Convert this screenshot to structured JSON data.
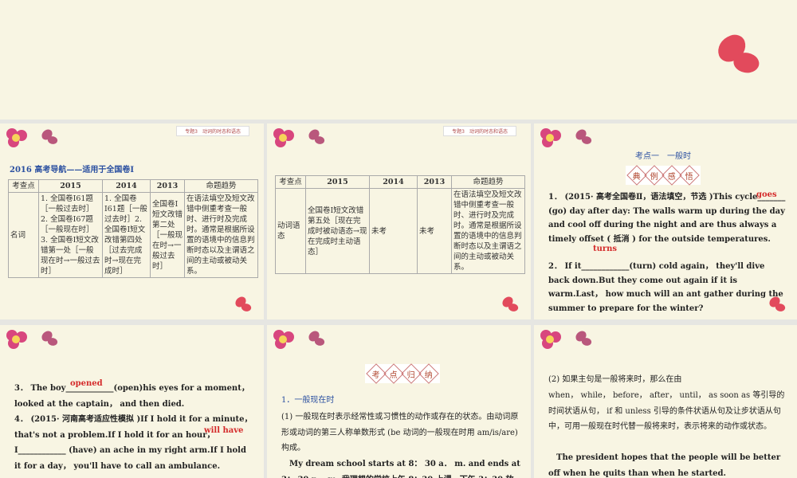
{
  "header_tag": "专题3　动词的时态和语态",
  "slide1": {
    "title": "2016 高考导航——适用于全国卷Ⅰ",
    "headers": [
      "考查点",
      "2015",
      "2014",
      "2013",
      "命题趋势"
    ],
    "row": [
      "名词",
      "1. 全国卷Ⅰ61题［一般过去时］2. 全国卷Ⅰ67题［一般现在时］3. 全国卷Ⅰ短文改错第一处［一般现在时→一般过去时］",
      "1. 全国卷Ⅰ61题［一般过去时］2. 全国卷Ⅰ短文改错第四处［过去完成时→现在完成时］",
      "全国卷Ⅰ短文改错第二处［一般现在时→一般过去时］",
      "在语法填空及短文改错中侧重考查一般时、进行时及完成时。通常是根据所设置的语境中的信息判断时态以及主谓语之间的主动或被动关系。"
    ]
  },
  "slide2": {
    "headers": [
      "考查点",
      "2015",
      "2014",
      "2013",
      "命题趋势"
    ],
    "row": [
      "动词语态",
      "全国卷Ⅰ短文改错第五处［现在完成时被动语态→现在完成时主动语态］",
      "未考",
      "未考",
      "在语法填空及短文改错中侧重考查一般时、进行时及完成时。通常是根据所设置的语境中的信息判断时态以及主谓语之间的主动或被动关系。"
    ]
  },
  "slide3": {
    "subtitle": "考点一　一般时",
    "badge": [
      "典",
      "例",
      "感",
      "悟"
    ],
    "q1": "1． (2015· 高考全国卷Ⅱ，语法填空，节选 )This cycle_______ (go) day after day: The walls warm up during the day and cool off during the night and are thus always a timely offset ( 抵消 ) for the outside temperatures.",
    "a1": "goes",
    "q2": "2． If it____________(turn) cold again， they'll dive back down.But they come out again if it is warm.Last， how much will an ant gather during the summer to prepare for the winter?",
    "a2": "turns"
  },
  "slide4": {
    "q3": "3． The boy____________(open)his eyes for a moment，looked at the captain， and then died.",
    "a3": "opened",
    "q4": "4． (2015· 河南高考适应性模拟 )If I hold it for a minute，that's not a problem.If I hold it for an hour， I____________ (have) an ache in my right arm.If I hold it for a day， you'll have to call an ambulance.",
    "a4": "will have"
  },
  "slide5": {
    "badge": [
      "考",
      "点",
      "归",
      "纳"
    ],
    "heading": "1．一般现在时",
    "p1": "(1) 一般现在时表示经常性或习惯性的动作或存在的状态。由动词原形或动词的第三人称单数形式 (be 动词的一般现在时用 am/is/are) 构成。",
    "example": "My dream school starts at 8： 30 a． m. and ends at 3： 30 p． m. 我理想的学校上午 8：30 上课，下午 3：30 放"
  },
  "slide6": {
    "p1": "(2) 如果主句是一般将来时，那么在由",
    "p2": "when， while， before， after， until， as soon as 等引导的时间状语从句， if 和 unless 引导的条件状语从句及让步状语从句中，可用一般现在时代替一般将来时，表示将来的动作或状态。",
    "example": "The president hopes that the people will be better off when he quits than when he started."
  }
}
